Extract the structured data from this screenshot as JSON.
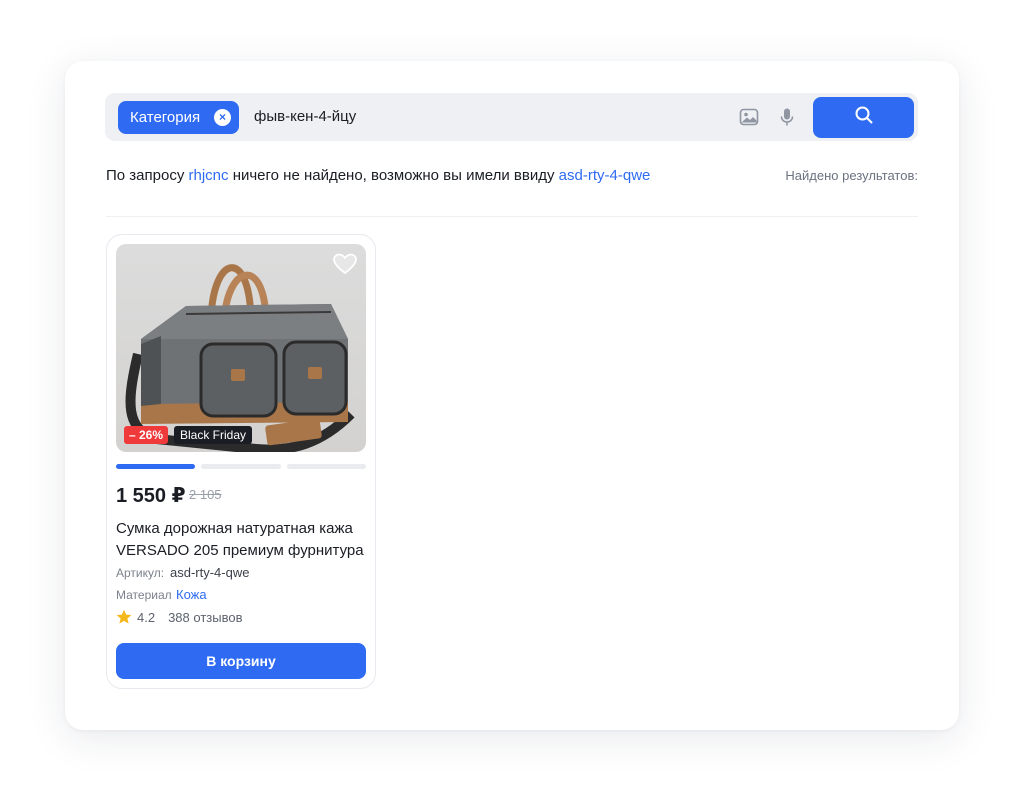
{
  "search": {
    "category_chip": "Категория",
    "category_chip_close": "×",
    "query_value": "фыв-кен-4-йцу"
  },
  "icons": {
    "image_search": "image-icon",
    "voice_search": "microphone-icon",
    "search": "search-icon",
    "favorite": "heart-icon",
    "star": "star-icon"
  },
  "hint": {
    "prefix": "По запросу",
    "query": "rhjcnc",
    "middle": "ничего не найдено, возможно вы имели ввиду",
    "suggestion": "asd-rty-4-qwe"
  },
  "results_label": "Найдено результатов:",
  "product": {
    "discount_badge": "– 26%",
    "promo_badge": "Black Friday",
    "gallery_active_index": 0,
    "gallery_count": 3,
    "price": "1 550 ₽",
    "old_price": "2 105",
    "title": "Сумка дорожная натуратная кажа VERSADO 205 премиум фурнитура",
    "sku_label": "Артикул:",
    "sku_value": "asd-rty-4-qwe",
    "material_label": "Материал",
    "material_value": "Кожа",
    "rating": "4.2",
    "reviews": "388 отзывов",
    "cart_button": "В корзину"
  },
  "colors": {
    "accent": "#2f6bf2",
    "discount": "#f0393a",
    "star": "#f5b81c",
    "searchbar_bg": "#eef0f4"
  }
}
